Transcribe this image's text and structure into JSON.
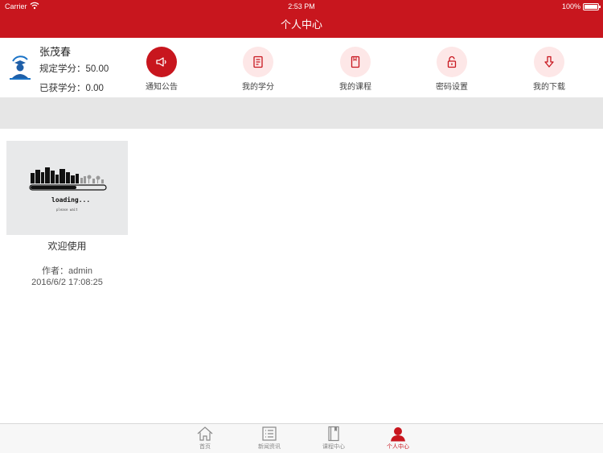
{
  "status_bar": {
    "carrier": "Carrier",
    "time": "2:53 PM",
    "battery": "100%"
  },
  "nav": {
    "title": "个人中心"
  },
  "profile": {
    "name": "张茂春",
    "required_credits_label": "规定学分：",
    "required_credits": "50.00",
    "earned_credits_label": "已获学分：",
    "earned_credits": "0.00"
  },
  "shortcuts": [
    {
      "label": "通知公告",
      "icon": "megaphone-icon"
    },
    {
      "label": "我的学分",
      "icon": "credits-icon"
    },
    {
      "label": "我的课程",
      "icon": "book-icon"
    },
    {
      "label": "密码设置",
      "icon": "lock-icon"
    },
    {
      "label": "我的下载",
      "icon": "download-icon"
    }
  ],
  "article": {
    "title": "欢迎使用",
    "author": "作者：admin",
    "date": "2016/6/2 17:08:25",
    "thumb_text": "loading...",
    "thumb_subtext": "please wait"
  },
  "tabs": [
    {
      "label": "首页",
      "icon": "home-icon"
    },
    {
      "label": "新闻资讯",
      "icon": "news-icon"
    },
    {
      "label": "课程中心",
      "icon": "course-icon"
    },
    {
      "label": "个人中心",
      "icon": "user-icon"
    }
  ],
  "colors": {
    "brand": "#c8161e",
    "shortcut_bg": "#fde7e7",
    "band": "#e6e6e6"
  }
}
